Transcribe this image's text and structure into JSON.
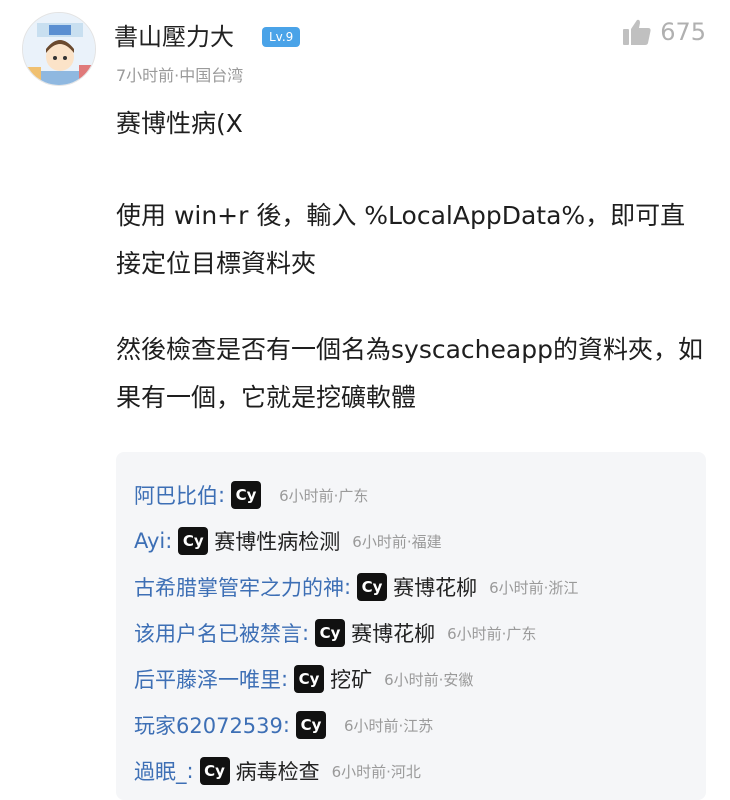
{
  "post": {
    "author": "書山壓力大",
    "level": "Lv.9",
    "meta": "7小时前·中国台湾",
    "likes": "675",
    "paragraphs": [
      "赛博性病(X",
      "使用 win+r 後，輸入 %LocalAppData%，即可直接定位目標資料夾",
      "然後檢查是否有一個名為syscacheapp的資料夾，如果有一個，它就是挖礦軟體"
    ]
  },
  "replies": [
    {
      "name": "阿巴比伯",
      "tag": "Cy",
      "text": "",
      "meta": "6小时前·广东"
    },
    {
      "name": "Ayi",
      "tag": "Cy",
      "text": "赛博性病检测",
      "meta": "6小时前·福建"
    },
    {
      "name": "古希腊掌管牢之力的神",
      "tag": "Cy",
      "text": "赛博花柳",
      "meta": "6小时前·浙江"
    },
    {
      "name": "该用户名已被禁言",
      "tag": "Cy",
      "text": "赛博花柳",
      "meta": "6小时前·广东"
    },
    {
      "name": "后平藤泽一唯里",
      "tag": "Cy",
      "text": "挖矿",
      "meta": "6小时前·安徽"
    },
    {
      "name": "玩家62072539",
      "tag": "Cy",
      "text": "",
      "meta": "6小时前·江苏"
    },
    {
      "name": "過眠_",
      "tag": "Cy",
      "text": "病毒检查",
      "meta": "6小时前·河北"
    }
  ],
  "colors": {
    "link": "#3d6fb5",
    "badge": "#4aa3e8",
    "reply_bg": "#f5f6f8",
    "muted": "#9a9a9a"
  },
  "icons": {
    "like": "thumbs-up-icon",
    "avatar": "cartoon-avatar"
  }
}
